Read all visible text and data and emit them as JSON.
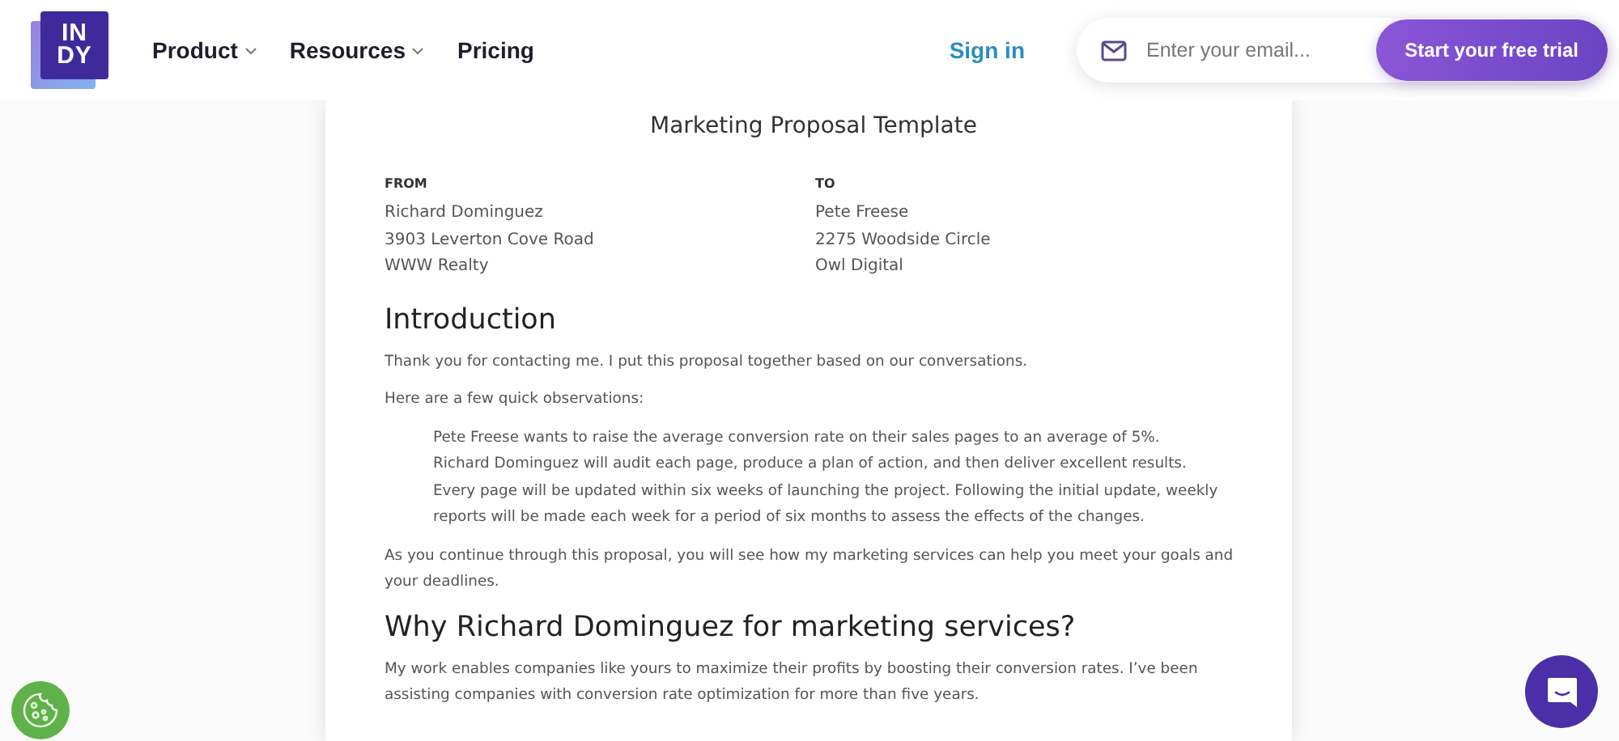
{
  "logo": {
    "top": "IN",
    "bottom": "DY"
  },
  "nav": [
    {
      "label": "Product",
      "dropdown": true
    },
    {
      "label": "Resources",
      "dropdown": true
    },
    {
      "label": "Pricing",
      "dropdown": false
    }
  ],
  "sign_in": "Sign in",
  "signup": {
    "placeholder": "Enter your email...",
    "button": "Start your free trial"
  },
  "document": {
    "title": "Marketing Proposal Template",
    "parties": [
      {
        "heading": "FROM",
        "lines": [
          "Richard Dominguez",
          "3903 Leverton Cove Road",
          "WWW Realty"
        ]
      },
      {
        "heading": "TO",
        "lines": [
          "Pete Freese",
          "2275 Woodside Circle",
          "Owl Digital"
        ]
      }
    ],
    "sections": [
      {
        "heading": "Introduction",
        "blocks": [
          {
            "kind": "paragraph",
            "text": "Thank you for contacting me. I put this proposal together based on our conversations."
          },
          {
            "kind": "paragraph",
            "text": "Here are a few quick observations:"
          },
          {
            "kind": "list",
            "items": [
              "Pete Freese wants to raise the average conversion rate on their sales pages to an average of 5%.",
              "Richard Dominguez will audit each page, produce a plan of action, and then deliver excellent results.",
              "Every page will be updated within six weeks of launching the project. Following the initial update, weekly reports will be made each week for a period of six months to assess the effects of the changes."
            ]
          },
          {
            "kind": "paragraph",
            "text": "As you continue through this proposal, you will see how my marketing services can help you meet your goals and your deadlines."
          }
        ]
      },
      {
        "heading": "Why Richard Dominguez for marketing services?",
        "blocks": [
          {
            "kind": "paragraph",
            "text": "My work enables companies like yours to maximize their profits by boosting their conversion rates. I’ve been assisting companies with conversion rate optimization for more than five years."
          }
        ]
      }
    ]
  }
}
